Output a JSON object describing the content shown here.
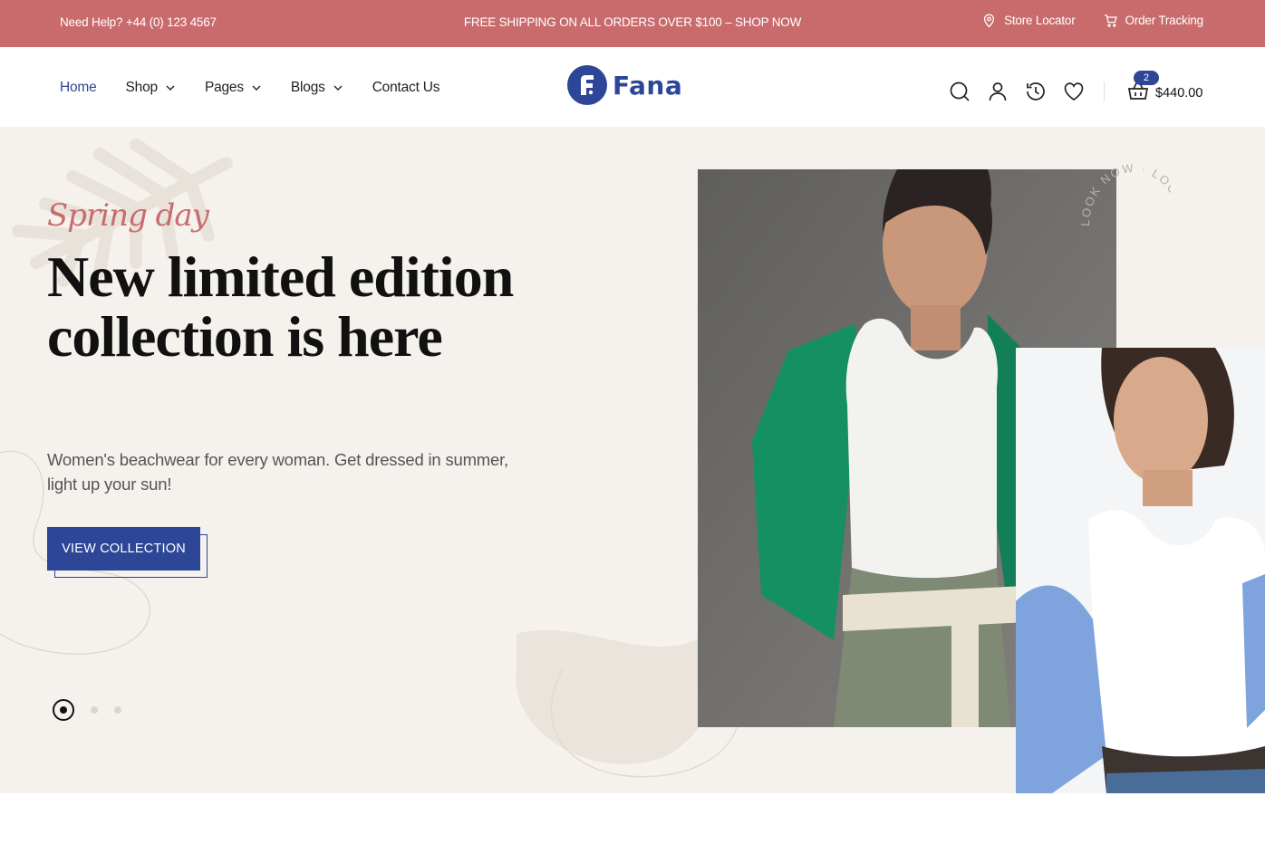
{
  "topbar": {
    "help": "Need Help? +44 (0) 123 4567",
    "promo": "FREE SHIPPING ON ALL ORDERS OVER $100  –  SHOP NOW",
    "store_locator": "Store Locator",
    "order_tracking": "Order Tracking",
    "bg_color": "#c96b6c"
  },
  "nav": {
    "home": "Home",
    "shop": "Shop",
    "pages": "Pages",
    "blogs": "Blogs",
    "contact": "Contact Us"
  },
  "logo": {
    "text": "Fana",
    "brand_color": "#2d4697"
  },
  "header_icons": [
    "search-icon",
    "user-icon",
    "history-icon",
    "heart-icon",
    "basket-icon"
  ],
  "cart": {
    "count": "2",
    "total": "$440.00"
  },
  "hero": {
    "eyebrow": "Spring day",
    "headline": "New limited edition collection is here",
    "subtitle": "Women's beachwear for every woman. Get dressed in summer, light up your sun!",
    "cta": "VIEW COLLECTION",
    "badge_text": "LOOK NOW · LOOK NOW ·",
    "slides": 3,
    "active_slide": 1
  }
}
